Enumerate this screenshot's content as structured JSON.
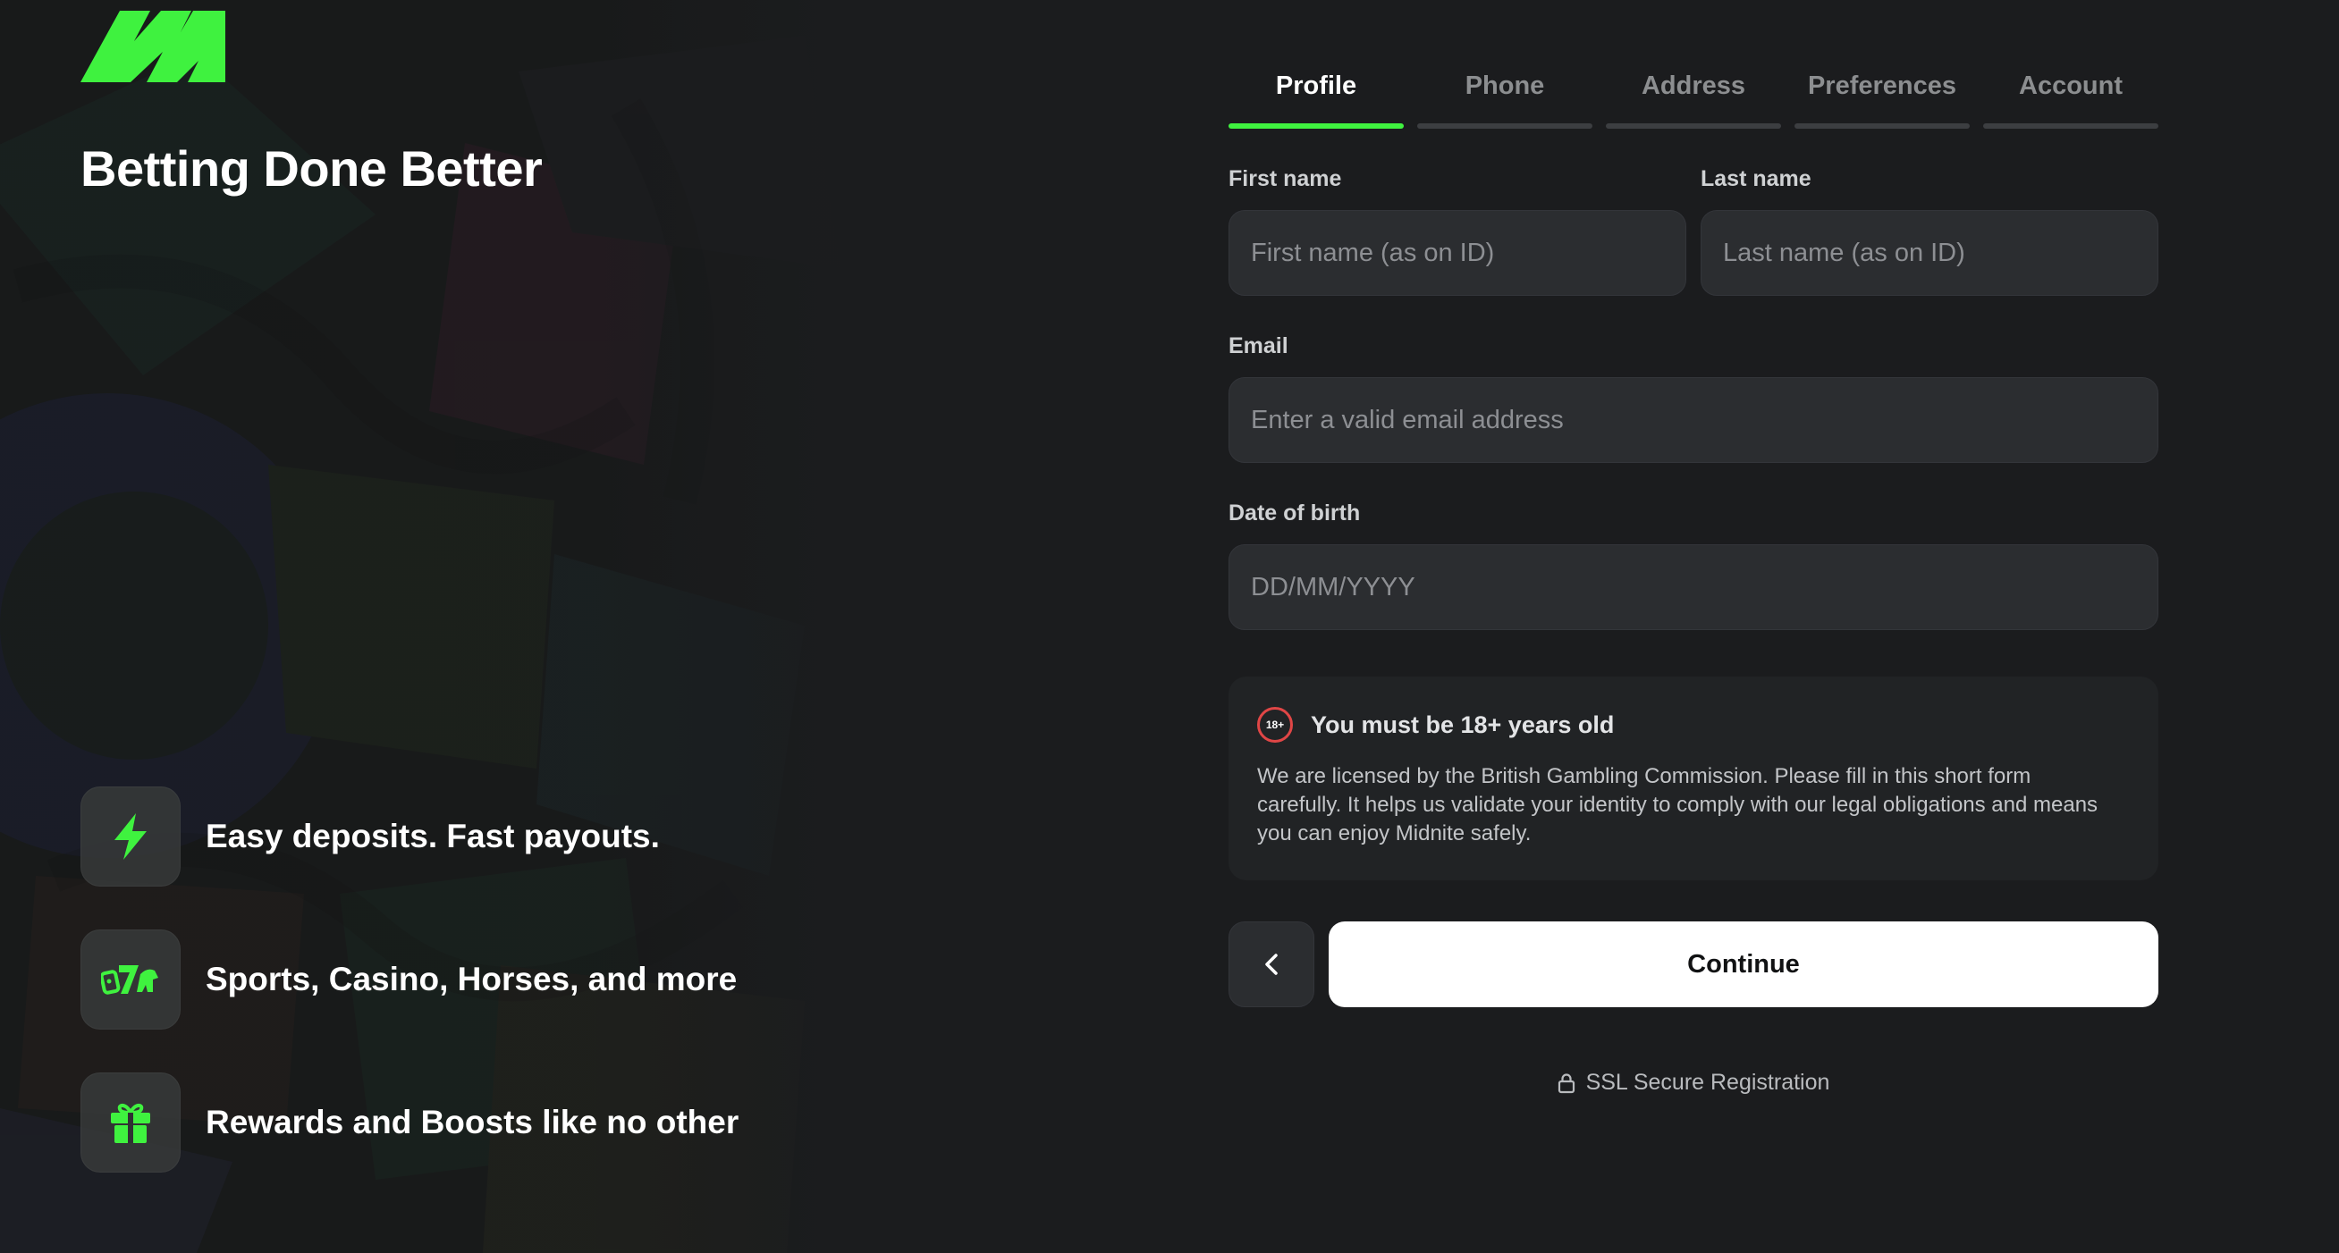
{
  "brand": {
    "logo_icon": "midnite-logo",
    "tagline": "Betting Done Better",
    "accent_color": "#3ff23f"
  },
  "features": [
    {
      "icon": "lightning-icon",
      "text": "Easy deposits. Fast payouts."
    },
    {
      "icon": "casino-horse-icon",
      "text": "Sports, Casino, Horses, and more"
    },
    {
      "icon": "gift-icon",
      "text": "Rewards and Boosts like no other"
    }
  ],
  "tabs": [
    {
      "label": "Profile",
      "active": true
    },
    {
      "label": "Phone",
      "active": false
    },
    {
      "label": "Address",
      "active": false
    },
    {
      "label": "Preferences",
      "active": false
    },
    {
      "label": "Account",
      "active": false
    }
  ],
  "form": {
    "first_name": {
      "label": "First name",
      "placeholder": "First name (as on ID)",
      "value": ""
    },
    "last_name": {
      "label": "Last name",
      "placeholder": "Last name (as on ID)",
      "value": ""
    },
    "email": {
      "label": "Email",
      "placeholder": "Enter a valid email address",
      "value": ""
    },
    "dob": {
      "label": "Date of birth",
      "placeholder": "DD/MM/YYYY",
      "value": ""
    }
  },
  "notice": {
    "badge": "18+",
    "title": "You must be 18+ years old",
    "body": "We are licensed by the British Gambling Commission. Please fill in this short form carefully. It helps us validate your identity to comply with our legal obligations and means you can enjoy Midnite safely."
  },
  "actions": {
    "back_icon": "chevron-left-icon",
    "continue_label": "Continue"
  },
  "footer": {
    "secure_icon": "lock-icon",
    "secure_text": "SSL Secure Registration"
  }
}
